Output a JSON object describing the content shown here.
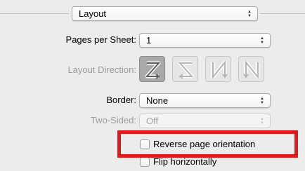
{
  "section_menu": {
    "selected": "Layout"
  },
  "pages_per_sheet": {
    "label": "Pages per Sheet:",
    "value": "1"
  },
  "layout_direction": {
    "label": "Layout Direction:",
    "options": [
      {
        "icon": "z-order-left-right-top-bottom-icon",
        "selected": true
      },
      {
        "icon": "s-order-right-left-top-bottom-icon",
        "selected": false
      },
      {
        "icon": "n-order-top-bottom-left-right-icon",
        "selected": false
      },
      {
        "icon": "n-order-top-bottom-right-left-icon",
        "selected": false
      }
    ]
  },
  "border": {
    "label": "Border:",
    "value": "None"
  },
  "two_sided": {
    "label": "Two-Sided:",
    "value": "Off",
    "enabled": false
  },
  "reverse_orientation": {
    "label": "Reverse page orientation",
    "checked": false
  },
  "flip_horizontally": {
    "label": "Flip horizontally",
    "checked": false
  },
  "annotation": {
    "color": "#e01a1a"
  }
}
